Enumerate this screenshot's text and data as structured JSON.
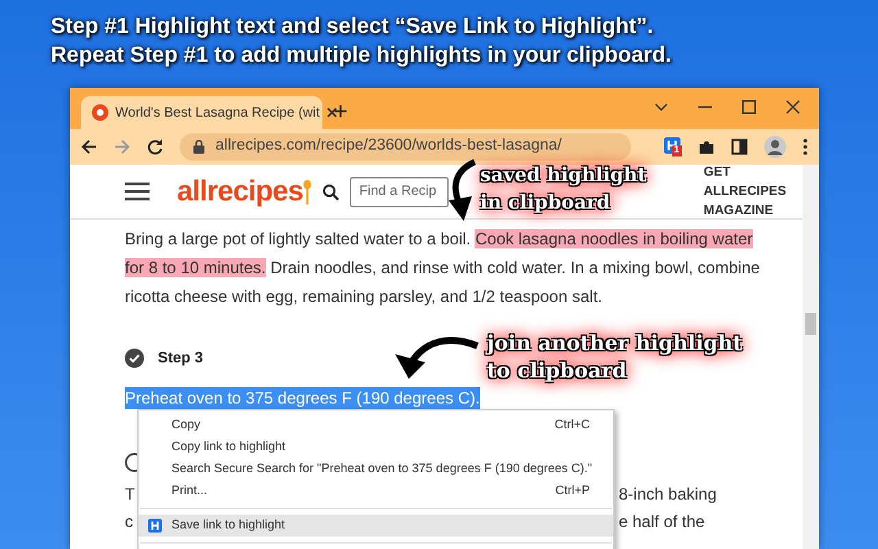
{
  "heading": [
    "Step #1 Highlight text and select “Save Link to Highlight”.",
    "Repeat Step #1 to add multiple highlights in your clipboard."
  ],
  "browser": {
    "tabs": [
      {
        "title": "World's Best Lasagna Recipe (wit",
        "selected": true
      }
    ],
    "new_tab": "+",
    "url": "allrecipes.com/recipe/23600/worlds-best-lasagna/",
    "extension_badge": "1"
  },
  "site": {
    "logo": "allrecipes",
    "search": {
      "placeholder": "Find a Recip"
    },
    "magazine_link": "GET ALLRECIPES MAGAZINE"
  },
  "paragraph": [
    {
      "text": "Bring a large pot of lightly salted water to a boil. ",
      "highlighted": false
    },
    {
      "text": "Cook lasagna noodles in boiling water for 8 to 10 minutes.",
      "highlighted": true
    },
    {
      "text": " Drain noodles, and rinse with cold water. In a mixing bowl, combine ricotta cheese with egg, remaining parsley, and 1/2 teaspoon salt.",
      "highlighted": false
    }
  ],
  "step": {
    "label": "Step 3",
    "done": true,
    "text": "Preheat oven to 375 degrees F (190 degrees C).",
    "selected": true
  },
  "partial_lines": [
    {
      "left": "T",
      "right": "8-inch baking"
    },
    {
      "left": "c",
      "right": "e half of the"
    }
  ],
  "context_menu": [
    {
      "kind": "command",
      "label": "Copy",
      "shortcut": "Ctrl+C",
      "selected": false
    },
    {
      "kind": "command",
      "label": "Copy link to highlight",
      "selected": false
    },
    {
      "kind": "command",
      "label": "Search Secure Search for \"Preheat oven to 375 degrees F (190 degrees C).\"",
      "selected": false
    },
    {
      "kind": "command",
      "label": "Print...",
      "shortcut": "Ctrl+P",
      "selected": false
    },
    {
      "kind": "separator"
    },
    {
      "kind": "extension",
      "label": "Save link to highlight",
      "selected": true
    },
    {
      "kind": "separator"
    }
  ],
  "callouts": [
    {
      "text": "saved highlight\nin clipboard"
    },
    {
      "text": "join another highlight\nto clipboard"
    }
  ]
}
